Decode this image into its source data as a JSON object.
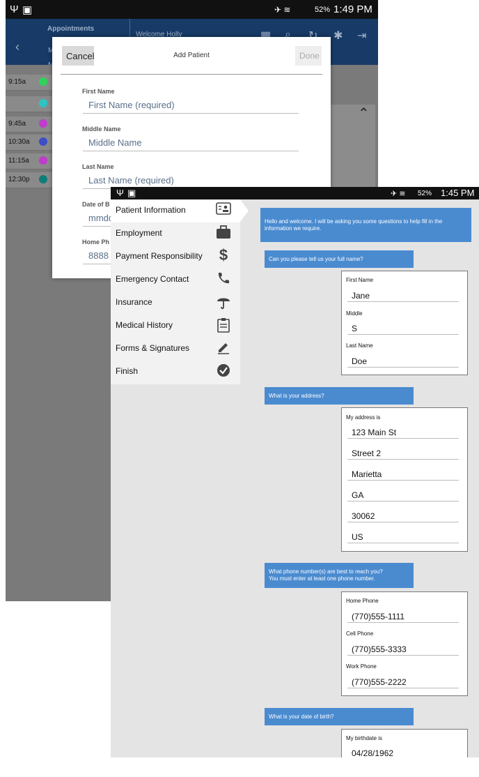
{
  "back": {
    "status_time": "1:49 PM",
    "battery": "52%",
    "appbar": {
      "appointments_label": "Appointments",
      "welcome": "Welcome Holly",
      "tab_m1": "M",
      "tab_m2": "M"
    },
    "schedule_times": [
      "9:15a",
      "",
      "9:45a",
      "10:30a",
      "11:15a",
      "12:30p"
    ],
    "dot_colors": [
      "#2fd35a",
      "#2ec4c4",
      "#c03ccc",
      "#3b4fc7",
      "#c03ccc",
      "#0e7d78"
    ]
  },
  "dialog": {
    "cancel": "Cancel",
    "title": "Add Patient",
    "done": "Done",
    "first_name_label": "First Name",
    "first_name_placeholder": "First Name (required)",
    "middle_name_label": "Middle Name",
    "middle_name_placeholder": "Middle Name",
    "last_name_label": "Last Name",
    "last_name_placeholder": "Last Name (required)",
    "dob_label": "Date of B",
    "dob_placeholder": "mmdd",
    "home_phone_label": "Home Ph",
    "home_phone_placeholder": "8888"
  },
  "front": {
    "status_time": "1:45 PM",
    "battery": "52%",
    "menu": [
      {
        "label": "Patient Information",
        "icon": "contact-card-icon"
      },
      {
        "label": "Employment",
        "icon": "briefcase-icon"
      },
      {
        "label": "Payment Responsibility",
        "icon": "dollar-icon"
      },
      {
        "label": "Emergency Contact",
        "icon": "phone-icon"
      },
      {
        "label": "Insurance",
        "icon": "umbrella-icon"
      },
      {
        "label": "Medical History",
        "icon": "clipboard-icon"
      },
      {
        "label": "Forms & Signatures",
        "icon": "pen-icon"
      },
      {
        "label": "Finish",
        "icon": "check-circle-icon"
      }
    ],
    "welcome_msg": "Hello and welcome.  I will be asking you some questions to help fill in the information we require.",
    "q_name": "Can you please tell us your full name?",
    "name_card": {
      "first_label": "First Name",
      "first_value": "Jane",
      "middle_label": "Middle",
      "middle_value": "S",
      "last_label": "Last Name",
      "last_value": "Doe"
    },
    "q_address": "What is your address?",
    "address_card": {
      "label": "My address is",
      "lines": [
        "123 Main St",
        "Street 2",
        "Marietta",
        "GA",
        "30062",
        "US"
      ]
    },
    "q_phone": "What phone number(s) are best to reach you?\nYou must enter at least one phone number.",
    "phone_card": {
      "home_label": "Home Phone",
      "home_value": "(770)555-1111",
      "cell_label": "Cell Phone",
      "cell_value": "(770)555-3333",
      "work_label": "Work Phone",
      "work_value": "(770)555-2222"
    },
    "q_dob": "What is your date of birth?",
    "dob_card": {
      "label": "My birthdate is",
      "value": "04/28/1962"
    }
  },
  "colors": {
    "accent_blue": "#4a8bd0",
    "appbar_navy": "#173a66"
  }
}
